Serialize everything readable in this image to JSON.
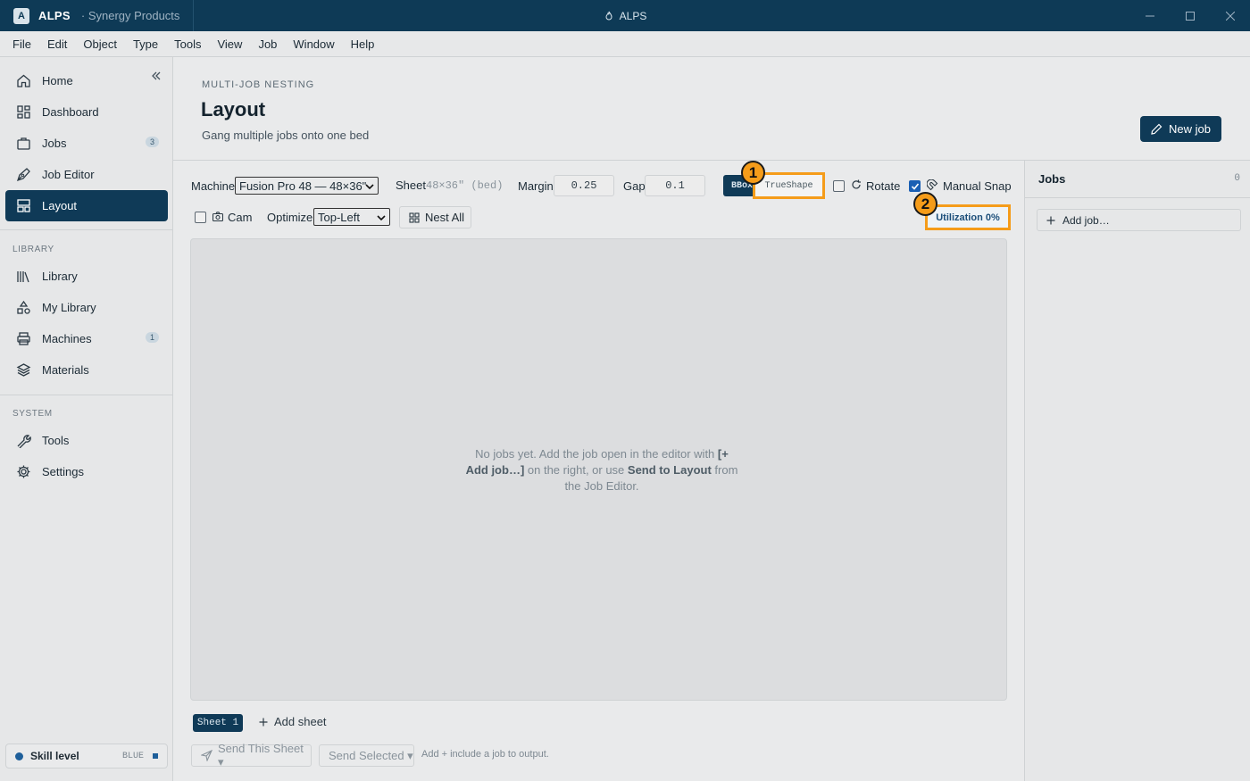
{
  "titlebar": {
    "app_badge": "A",
    "app_name": "ALPS",
    "org": "· Synergy Products",
    "window_title": "ALPS"
  },
  "menu": [
    "File",
    "Edit",
    "Object",
    "Type",
    "Tools",
    "View",
    "Job",
    "Window",
    "Help"
  ],
  "sidebar": {
    "main_items": [
      {
        "label": "Home",
        "icon": "home-icon"
      },
      {
        "label": "Dashboard",
        "icon": "dashboard-icon"
      },
      {
        "label": "Jobs",
        "icon": "briefcase-icon",
        "count": "3"
      },
      {
        "label": "Job Editor",
        "icon": "pen-icon"
      },
      {
        "label": "Layout",
        "icon": "layout-icon",
        "active": true
      }
    ],
    "library_label": "LIBRARY",
    "library_items": [
      {
        "label": "Library",
        "icon": "library-icon"
      },
      {
        "label": "My Library",
        "icon": "shapes-icon"
      },
      {
        "label": "Machines",
        "icon": "printer-icon",
        "count": "1"
      },
      {
        "label": "Materials",
        "icon": "layers-icon"
      }
    ],
    "system_label": "SYSTEM",
    "system_items": [
      {
        "label": "Tools",
        "icon": "wrench-icon"
      },
      {
        "label": "Settings",
        "icon": "gear-icon"
      }
    ],
    "skill": {
      "label": "Skill level",
      "level": "BLUE",
      "color": "#1e5f9a"
    }
  },
  "header": {
    "eyebrow": "MULTI-JOB NESTING",
    "title": "Layout",
    "subtitle": "Gang multiple jobs onto one bed",
    "new_job": "New job"
  },
  "toolbar": {
    "machine_label": "Machine",
    "machine_value": "Fusion Pro 48 — 48×36\"",
    "sheet_label": "Sheet",
    "sheet_value": "48×36\" (bed)",
    "margin_label": "Margin",
    "margin_value": "0.25",
    "gap_label": "Gap",
    "gap_value": "0.1",
    "mode_bbox": "BBox",
    "mode_trueshape": "TrueShape",
    "rotate_label": "Rotate",
    "rotate_checked": false,
    "manual_snap_label": "Manual Snap",
    "manual_snap_checked": true,
    "cam_label": "Cam",
    "cam_checked": false,
    "optimize_label": "Optimize",
    "optimize_value": "Top-Left",
    "nest_all": "Nest All",
    "utilization": "Utilization 0%"
  },
  "annotations": {
    "badge1": "1",
    "badge2": "2",
    "highlight_color": "#f59c1a"
  },
  "canvas": {
    "empty_a": "No jobs yet. Add the job open in the editor with ",
    "empty_b": "[+ Add job…]",
    "empty_c": " on the right, or use ",
    "empty_d": "Send to Layout",
    "empty_e": " from the Job Editor."
  },
  "bottom": {
    "sheet_tab": "Sheet 1",
    "add_sheet": "Add sheet",
    "send_this": "Send This Sheet ▾",
    "send_selected": "Send Selected ▾",
    "hint": "Add + include a job to output."
  },
  "jobs_panel": {
    "title": "Jobs",
    "count": "0",
    "add_job": "Add job…"
  }
}
